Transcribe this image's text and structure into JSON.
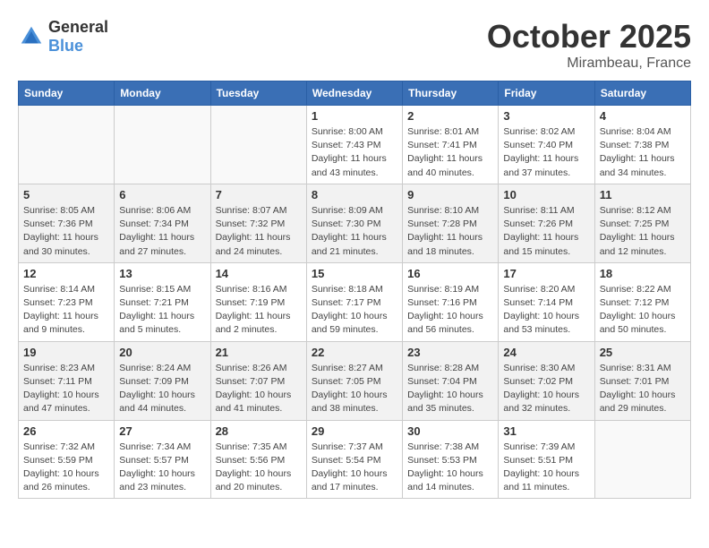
{
  "header": {
    "logo_general": "General",
    "logo_blue": "Blue",
    "title": "October 2025",
    "location": "Mirambeau, France"
  },
  "days_of_week": [
    "Sunday",
    "Monday",
    "Tuesday",
    "Wednesday",
    "Thursday",
    "Friday",
    "Saturday"
  ],
  "weeks": [
    {
      "shade": false,
      "days": [
        {
          "num": "",
          "info": ""
        },
        {
          "num": "",
          "info": ""
        },
        {
          "num": "",
          "info": ""
        },
        {
          "num": "1",
          "info": "Sunrise: 8:00 AM\nSunset: 7:43 PM\nDaylight: 11 hours\nand 43 minutes."
        },
        {
          "num": "2",
          "info": "Sunrise: 8:01 AM\nSunset: 7:41 PM\nDaylight: 11 hours\nand 40 minutes."
        },
        {
          "num": "3",
          "info": "Sunrise: 8:02 AM\nSunset: 7:40 PM\nDaylight: 11 hours\nand 37 minutes."
        },
        {
          "num": "4",
          "info": "Sunrise: 8:04 AM\nSunset: 7:38 PM\nDaylight: 11 hours\nand 34 minutes."
        }
      ]
    },
    {
      "shade": true,
      "days": [
        {
          "num": "5",
          "info": "Sunrise: 8:05 AM\nSunset: 7:36 PM\nDaylight: 11 hours\nand 30 minutes."
        },
        {
          "num": "6",
          "info": "Sunrise: 8:06 AM\nSunset: 7:34 PM\nDaylight: 11 hours\nand 27 minutes."
        },
        {
          "num": "7",
          "info": "Sunrise: 8:07 AM\nSunset: 7:32 PM\nDaylight: 11 hours\nand 24 minutes."
        },
        {
          "num": "8",
          "info": "Sunrise: 8:09 AM\nSunset: 7:30 PM\nDaylight: 11 hours\nand 21 minutes."
        },
        {
          "num": "9",
          "info": "Sunrise: 8:10 AM\nSunset: 7:28 PM\nDaylight: 11 hours\nand 18 minutes."
        },
        {
          "num": "10",
          "info": "Sunrise: 8:11 AM\nSunset: 7:26 PM\nDaylight: 11 hours\nand 15 minutes."
        },
        {
          "num": "11",
          "info": "Sunrise: 8:12 AM\nSunset: 7:25 PM\nDaylight: 11 hours\nand 12 minutes."
        }
      ]
    },
    {
      "shade": false,
      "days": [
        {
          "num": "12",
          "info": "Sunrise: 8:14 AM\nSunset: 7:23 PM\nDaylight: 11 hours\nand 9 minutes."
        },
        {
          "num": "13",
          "info": "Sunrise: 8:15 AM\nSunset: 7:21 PM\nDaylight: 11 hours\nand 5 minutes."
        },
        {
          "num": "14",
          "info": "Sunrise: 8:16 AM\nSunset: 7:19 PM\nDaylight: 11 hours\nand 2 minutes."
        },
        {
          "num": "15",
          "info": "Sunrise: 8:18 AM\nSunset: 7:17 PM\nDaylight: 10 hours\nand 59 minutes."
        },
        {
          "num": "16",
          "info": "Sunrise: 8:19 AM\nSunset: 7:16 PM\nDaylight: 10 hours\nand 56 minutes."
        },
        {
          "num": "17",
          "info": "Sunrise: 8:20 AM\nSunset: 7:14 PM\nDaylight: 10 hours\nand 53 minutes."
        },
        {
          "num": "18",
          "info": "Sunrise: 8:22 AM\nSunset: 7:12 PM\nDaylight: 10 hours\nand 50 minutes."
        }
      ]
    },
    {
      "shade": true,
      "days": [
        {
          "num": "19",
          "info": "Sunrise: 8:23 AM\nSunset: 7:11 PM\nDaylight: 10 hours\nand 47 minutes."
        },
        {
          "num": "20",
          "info": "Sunrise: 8:24 AM\nSunset: 7:09 PM\nDaylight: 10 hours\nand 44 minutes."
        },
        {
          "num": "21",
          "info": "Sunrise: 8:26 AM\nSunset: 7:07 PM\nDaylight: 10 hours\nand 41 minutes."
        },
        {
          "num": "22",
          "info": "Sunrise: 8:27 AM\nSunset: 7:05 PM\nDaylight: 10 hours\nand 38 minutes."
        },
        {
          "num": "23",
          "info": "Sunrise: 8:28 AM\nSunset: 7:04 PM\nDaylight: 10 hours\nand 35 minutes."
        },
        {
          "num": "24",
          "info": "Sunrise: 8:30 AM\nSunset: 7:02 PM\nDaylight: 10 hours\nand 32 minutes."
        },
        {
          "num": "25",
          "info": "Sunrise: 8:31 AM\nSunset: 7:01 PM\nDaylight: 10 hours\nand 29 minutes."
        }
      ]
    },
    {
      "shade": false,
      "days": [
        {
          "num": "26",
          "info": "Sunrise: 7:32 AM\nSunset: 5:59 PM\nDaylight: 10 hours\nand 26 minutes."
        },
        {
          "num": "27",
          "info": "Sunrise: 7:34 AM\nSunset: 5:57 PM\nDaylight: 10 hours\nand 23 minutes."
        },
        {
          "num": "28",
          "info": "Sunrise: 7:35 AM\nSunset: 5:56 PM\nDaylight: 10 hours\nand 20 minutes."
        },
        {
          "num": "29",
          "info": "Sunrise: 7:37 AM\nSunset: 5:54 PM\nDaylight: 10 hours\nand 17 minutes."
        },
        {
          "num": "30",
          "info": "Sunrise: 7:38 AM\nSunset: 5:53 PM\nDaylight: 10 hours\nand 14 minutes."
        },
        {
          "num": "31",
          "info": "Sunrise: 7:39 AM\nSunset: 5:51 PM\nDaylight: 10 hours\nand 11 minutes."
        },
        {
          "num": "",
          "info": ""
        }
      ]
    }
  ]
}
